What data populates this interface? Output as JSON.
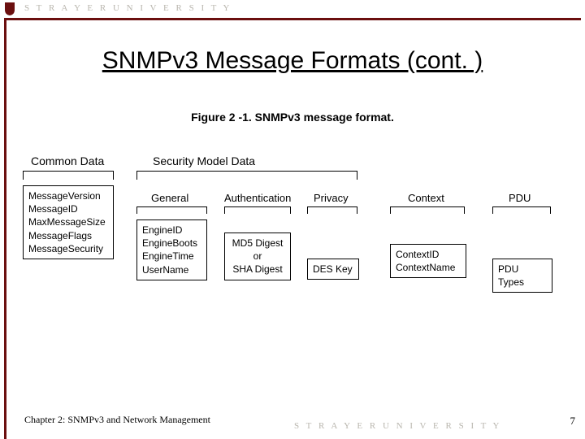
{
  "brand_top": "S T R A Y E R   U N I V E R S I T Y",
  "title": "SNMPv3 Message Formats (cont. )",
  "caption": "Figure 2 -1. SNMPv3 message format.",
  "groups": {
    "common": "Common Data",
    "security": "Security Model Data"
  },
  "subs": {
    "general": "General",
    "auth": "Authentication",
    "privacy": "Privacy",
    "context": "Context",
    "pdu": "PDU"
  },
  "boxes": {
    "common": "MessageVersion\nMessageID\nMaxMessageSize\nMessageFlags\nMessageSecurity",
    "general": "EngineID\nEngineBoots\nEngineTime\nUserName",
    "auth": "MD5 Digest\nor\nSHA Digest",
    "privacy": "DES Key",
    "context": "ContextID\nContextName",
    "pdu": "PDU Types"
  },
  "footer_chapter": "Chapter 2: SNMPv3 and Network Management",
  "brand_bottom": "S T R A Y E R   U N I V E R S I T Y",
  "page_no": "7"
}
